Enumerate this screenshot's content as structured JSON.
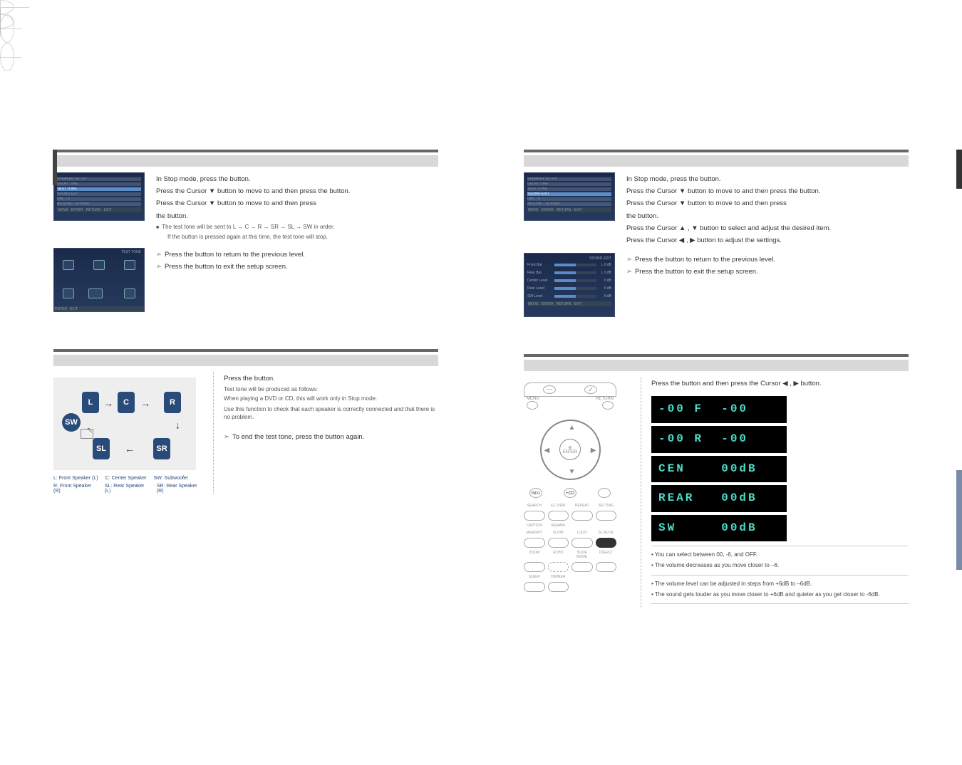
{
  "left": {
    "step1": {
      "l1a": "In Stop mode, press the ",
      "l1b": " button.",
      "l2a": "Press the Cursor ▼ button to move to ",
      "l2b": " and then press the ",
      "l2c": " button.",
      "l3a": "Press the Cursor ▼ button to move to ",
      "l3b": " and then press",
      "l4a": "the ",
      "l4b": " button.",
      "bullet1": "The test tone will be sent to L → C → R → SR → SL → SW in order.",
      "bullet2a": "If the ",
      "bullet2b": " button is pressed again at this time, the test tone will stop."
    },
    "step2": {
      "r1a": "Press the ",
      "r1b": " button to return to the previous level.",
      "r2a": "Press the ",
      "r2b": " button to exit the setup screen."
    },
    "lower": {
      "p1a": "Press the ",
      "p1b": " button.",
      "s1": "Test tone will be produced as follows:",
      "s2": "When playing a DVD or CD, this will work only in Stop mode.",
      "s3": "Use this function to check that each speaker is correctly connected and that there is no problem.",
      "e1a": "To end the test tone, press the ",
      "e1b": " button again."
    },
    "legend": {
      "L": "L: Front Speaker (L)",
      "C": "C: Center Speaker",
      "SW": "SW: Subwoofer",
      "R": "R: Front Speaker (R)",
      "SL": "SL: Rear Speaker (L)",
      "SR": "SR: Rear Speaker (R)"
    },
    "spk": {
      "L": "L",
      "C": "C",
      "R": "R",
      "SW": "SW",
      "SL": "SL",
      "SR": "SR"
    },
    "menu": {
      "t1": "SPEAKER SETUP",
      "t2": "DELAY TIME",
      "t3": "TEST TONE",
      "t4": "SOUND EDIT",
      "t5": "DRC          : 6",
      "t6": "AV-SYNC      : 50 mSec",
      "f1": "MOVE",
      "f2": "ENTER",
      "f3": "RETURN",
      "f4": "EXIT",
      "tt": "TEST TONE"
    }
  },
  "right": {
    "step1": {
      "l1a": "In Stop mode, press the ",
      "l1b": " button.",
      "l2a": "Press the Cursor ▼ button to move to ",
      "l2b": " and then press the ",
      "l2c": " button.",
      "l3a": "Press the Cursor ▼ button to move to ",
      "l3b": " and then press",
      "l4a": "the ",
      "l4b": " button.",
      "l5": "Press the Cursor ▲ , ▼ button to select and adjust the desired item.",
      "l6": "Press the Cursor ◀ , ▶ button to adjust the settings."
    },
    "step2": {
      "r1a": "Press the ",
      "r1b": " button to return to the previous level.",
      "r2a": "Press the ",
      "r2b": " button to exit the setup screen."
    },
    "lower": {
      "p1a": "Press the ",
      "p1b": " button and then press the Cursor ◀ , ▶ button."
    },
    "lcd": {
      "r1": "-00 F  -00",
      "r2": "-00 R  -00",
      "r3": "CEN    00dB",
      "r4": "REAR   00dB",
      "r5": "SW     00dB"
    },
    "notes": {
      "n1": "• You can select between 00, -6, and OFF.",
      "n2": "• The volume decreases as you move closer to –6.",
      "n3": "• The volume level can be adjusted in steps from +6dB to –6dB.",
      "n4": "• The sound gets louder as you move closer to +6dB and quieter as you get closer to -6dB."
    },
    "remote": {
      "menu": "MENU",
      "return": "RETURN",
      "enter": "ENTER",
      "info": "INFO",
      "search": "SEARCH",
      "ezview": "EZ VIEW",
      "repeat": "REPEAT",
      "setting": "SETTING",
      "caption": "CAPTION",
      "remain": "REMAIN",
      "empty1": "",
      "empty2": "",
      "memory": "MEMORY",
      "slow": "SLOW",
      "logo": "LOGO",
      "slmute": "SL MUTE",
      "zoom": "ZOOM",
      "echo": "ECHO",
      "slide": "SLIDE MODE",
      "digest": "DIGEST",
      "sleep": "SLEEP",
      "dimmer": "DIMMER"
    },
    "levels": {
      "t": "SOUND EDIT",
      "r1": "Front Bal.",
      "r2": "Rear Bal.",
      "r3": "Center Level",
      "r4": "Rear Level",
      "r5": "SW Level",
      "v1": "L 0 dB",
      "v2": "L 0 dB",
      "v3": "0 dB",
      "v4": "0 dB",
      "v5": "0 dB"
    },
    "menu": {
      "t1": "SPEAKER SETUP",
      "t2": "DELAY TIME",
      "t3": "TEST TONE",
      "t4": "SOUND EDIT",
      "t5": "DRC          : 6",
      "t6": "AV-SYNC      : 50 mSec",
      "f1": "MOVE",
      "f2": "ENTER",
      "f3": "RETURN",
      "f4": "EXIT"
    }
  }
}
